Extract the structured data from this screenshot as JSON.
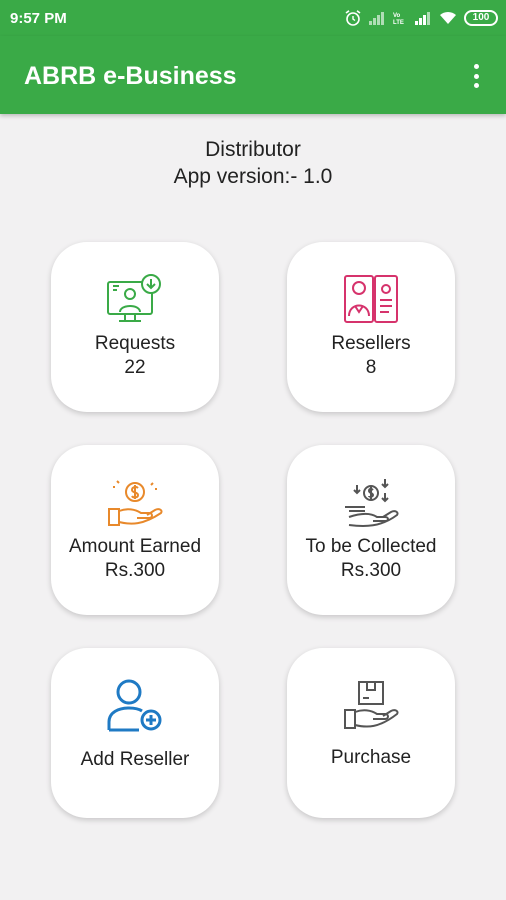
{
  "status_bar": {
    "time": "9:57 PM",
    "battery": "100"
  },
  "app_bar": {
    "title": "ABRB e-Business"
  },
  "header": {
    "role": "Distributor",
    "version": "App version:- 1.0"
  },
  "cards": [
    {
      "label": "Requests",
      "value": "22",
      "icon": "requests-icon",
      "color": "#3aaa47"
    },
    {
      "label": "Resellers",
      "value": "8",
      "icon": "resellers-icon",
      "color": "#d6336c"
    },
    {
      "label": "Amount Earned",
      "value": "Rs.300",
      "icon": "money-hand-icon",
      "color": "#e8892b"
    },
    {
      "label": "To be Collected",
      "value": "Rs.300",
      "icon": "collect-money-icon",
      "color": "#555555"
    },
    {
      "label": "Add Reseller",
      "icon": "add-user-icon",
      "color": "#1f7ac4"
    },
    {
      "label": "Purchase",
      "icon": "purchase-box-icon",
      "color": "#555555"
    }
  ],
  "colors": {
    "primary": "#3aaa47",
    "background": "#f2f1f2"
  }
}
